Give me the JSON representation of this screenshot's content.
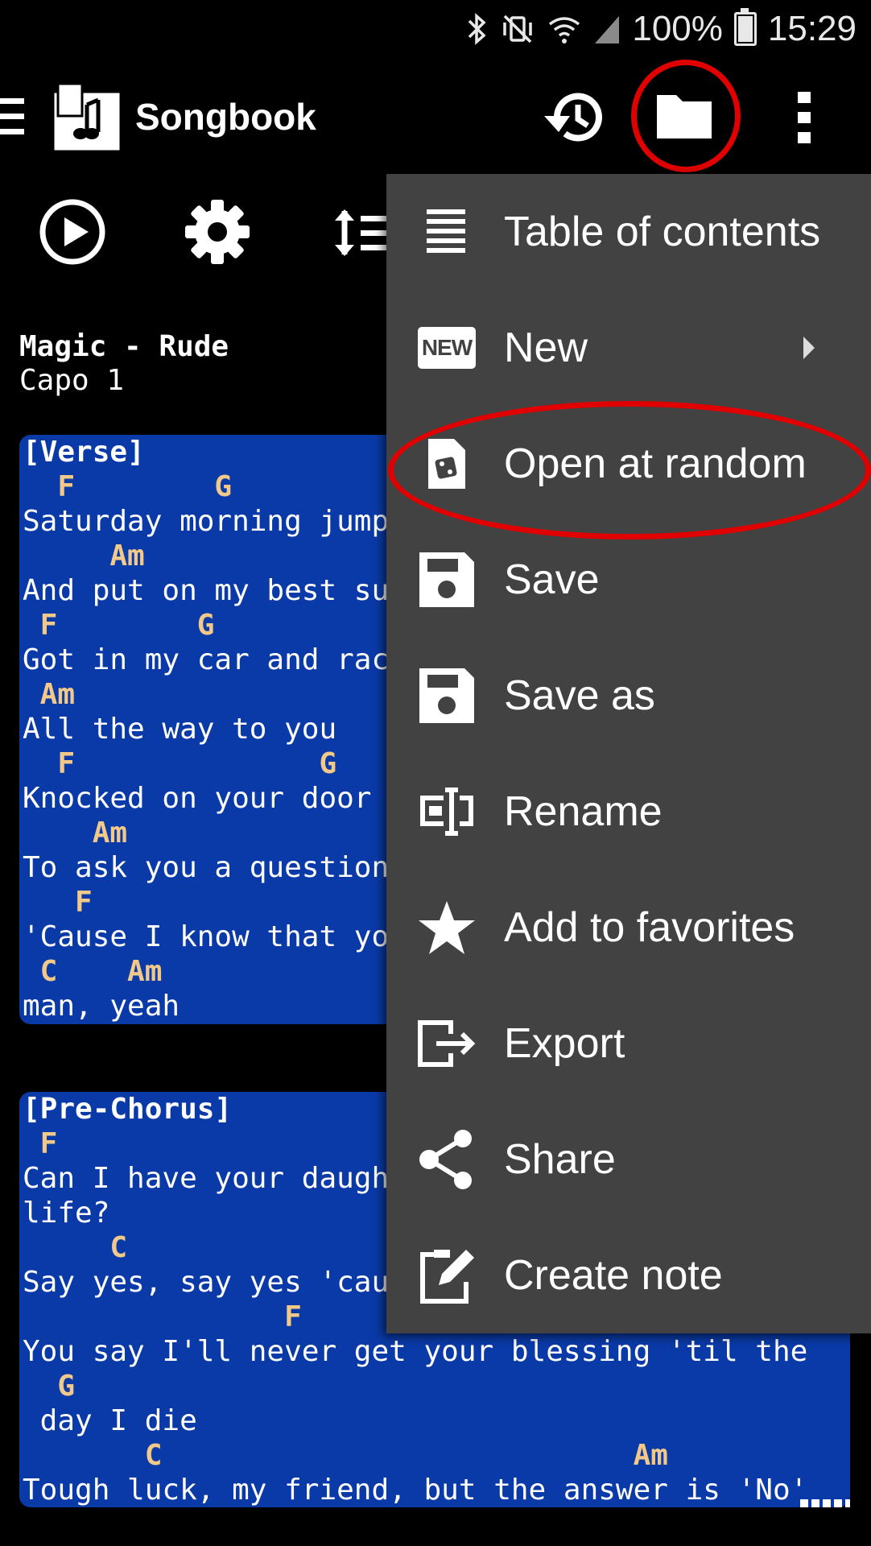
{
  "status_bar": {
    "battery": "100%",
    "time": "15:29"
  },
  "app_bar": {
    "title": "Songbook"
  },
  "song": {
    "title": "Magic - Rude",
    "capo": "Capo 1",
    "verse": [
      {
        "t": "hdr",
        "s": "[Verse]"
      },
      {
        "t": "ch",
        "s": "  F        G"
      },
      {
        "t": "ly",
        "s": "Saturday morning jump"
      },
      {
        "t": "ch",
        "s": "     Am"
      },
      {
        "t": "ly",
        "s": "And put on my best su"
      },
      {
        "t": "ch",
        "s": " F        G"
      },
      {
        "t": "ly",
        "s": "Got in my car and rac"
      },
      {
        "t": "ch",
        "s": " Am"
      },
      {
        "t": "ly",
        "s": "All the way to you"
      },
      {
        "t": "ch",
        "s": "  F              G"
      },
      {
        "t": "ly",
        "s": "Knocked on your door"
      },
      {
        "t": "ch",
        "s": "    Am"
      },
      {
        "t": "ly",
        "s": "To ask you a question"
      },
      {
        "t": "ch",
        "s": "   F"
      },
      {
        "t": "ly",
        "s": "'Cause I know that yo"
      },
      {
        "t": "ch",
        "s": " C    Am"
      },
      {
        "t": "ly",
        "s": "man, yeah"
      }
    ],
    "prechorus": [
      {
        "t": "hdr",
        "s": "[Pre-Chorus]"
      },
      {
        "t": "ch",
        "s": " F"
      },
      {
        "t": "ly",
        "s": "Can I have your daugh"
      },
      {
        "t": "ly",
        "s": "life?"
      },
      {
        "t": "ch",
        "s": "     C"
      },
      {
        "t": "ly",
        "s": "Say yes, say yes 'cau"
      },
      {
        "t": "ch",
        "s": "               F"
      },
      {
        "t": "ly",
        "s": "You say I'll never get your blessing 'til the"
      },
      {
        "t": "ch",
        "s": "  G"
      },
      {
        "t": "ly",
        "s": " day I die"
      },
      {
        "t": "ch",
        "s": "       C                           Am"
      },
      {
        "t": "ly",
        "s": "Tough luck, my friend, but the answer is 'No'"
      }
    ]
  },
  "menu": {
    "items": [
      {
        "label": "Table of contents",
        "icon": "list-icon"
      },
      {
        "label": "New",
        "icon": "new-badge-icon",
        "badge": "NEW"
      },
      {
        "label": "Open at random",
        "icon": "dice-file-icon"
      },
      {
        "label": "Save",
        "icon": "floppy-disk-icon"
      },
      {
        "label": "Save as",
        "icon": "floppy-disk-icon"
      },
      {
        "label": "Rename",
        "icon": "rename-icon"
      },
      {
        "label": "Add to favorites",
        "icon": "star-icon"
      },
      {
        "label": "Export",
        "icon": "export-icon"
      },
      {
        "label": "Share",
        "icon": "share-icon"
      },
      {
        "label": "Create note",
        "icon": "note-icon"
      }
    ]
  },
  "colors": {
    "lyrics_bg": "#0a3aa8",
    "chord": "#f3c98a",
    "menu_bg": "#424242",
    "annotation": "#e00000"
  }
}
